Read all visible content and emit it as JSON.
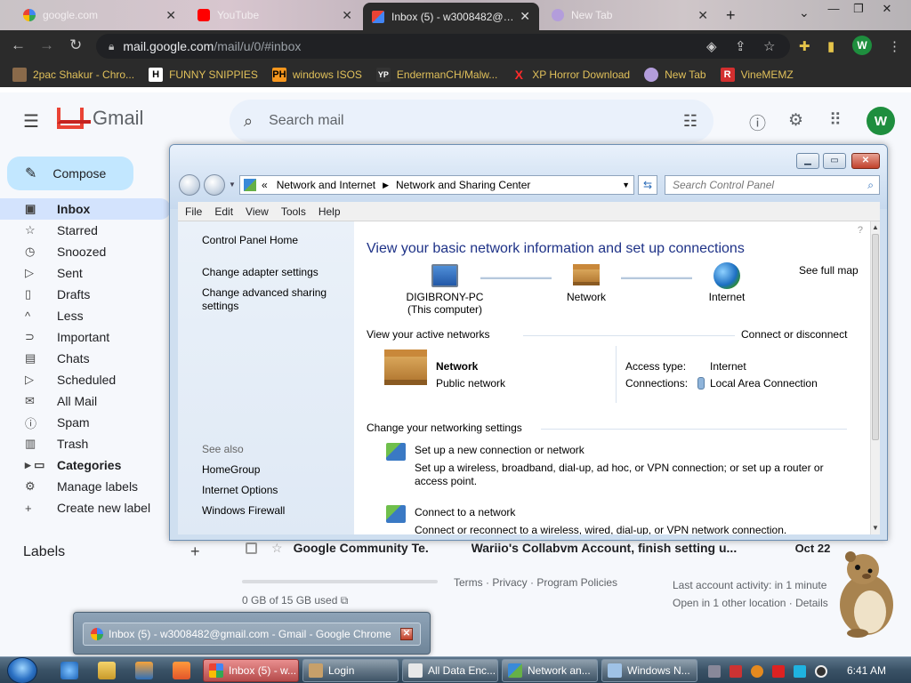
{
  "chrome": {
    "tabs": [
      {
        "title": "google.com"
      },
      {
        "title": "YouTube"
      },
      {
        "title": "Inbox (5) - w3008482@gmail.com"
      },
      {
        "title": "New Tab"
      }
    ],
    "url_host": "mail.google.com",
    "url_path": "/mail/u/0/#inbox",
    "profile_initial": "W",
    "bookmarks": [
      {
        "label": "2pac Shakur - Chro..."
      },
      {
        "label": "FUNNY SNIPPIES",
        "mark": "H"
      },
      {
        "label": "windows ISOS",
        "mark": "PH"
      },
      {
        "label": "EndermanCH/Malw...",
        "mark": "YP"
      },
      {
        "label": "XP Horror Download",
        "mark": "X"
      },
      {
        "label": "New Tab"
      },
      {
        "label": "VineMEMZ",
        "mark": "R"
      }
    ]
  },
  "gmail": {
    "brand": "Gmail",
    "search_placeholder": "Search mail",
    "avatar": "W",
    "compose": "Compose",
    "nav": [
      {
        "label": "Inbox",
        "icon": "inbox-icon"
      },
      {
        "label": "Starred",
        "icon": "star-icon"
      },
      {
        "label": "Snoozed",
        "icon": "clock-icon"
      },
      {
        "label": "Sent",
        "icon": "send-icon"
      },
      {
        "label": "Drafts",
        "icon": "draft-icon"
      },
      {
        "label": "Less",
        "icon": "chevron-up-icon"
      },
      {
        "label": "Important",
        "icon": "important-icon"
      },
      {
        "label": "Chats",
        "icon": "chat-icon"
      },
      {
        "label": "Scheduled",
        "icon": "schedule-icon"
      },
      {
        "label": "All Mail",
        "icon": "mail-icon"
      },
      {
        "label": "Spam",
        "icon": "spam-icon"
      },
      {
        "label": "Trash",
        "icon": "trash-icon"
      },
      {
        "label": "Categories",
        "icon": "label-icon"
      },
      {
        "label": "Manage labels",
        "icon": "gear-icon"
      },
      {
        "label": "Create new label",
        "icon": "plus-icon"
      }
    ],
    "labels_title": "Labels",
    "email": {
      "sender": "Google Community Te.",
      "subject": "Wariio's Collabvm Account, finish setting u...",
      "date": "Oct 22"
    },
    "storage": "0 GB of 15 GB used",
    "footer_links": "Terms · Privacy · Program Policies",
    "activity_line1": "Last account activity: in 1 minute",
    "activity_line2": "Open in 1 other location · Details"
  },
  "control_panel": {
    "breadcrumb_root": "«",
    "breadcrumb_1": "Network and Internet",
    "breadcrumb_2": "Network and Sharing Center",
    "search_placeholder": "Search Control Panel",
    "menu": [
      "File",
      "Edit",
      "View",
      "Tools",
      "Help"
    ],
    "left_links": {
      "home": "Control Panel Home",
      "adapter": "Change adapter settings",
      "sharing": "Change advanced sharing settings"
    },
    "see_also": {
      "title": "See also",
      "items": [
        "HomeGroup",
        "Internet Options",
        "Windows Firewall"
      ]
    },
    "main_title": "View your basic network information and set up connections",
    "see_full_map": "See full map",
    "nodes": {
      "computer": "DIGIBRONY-PC",
      "computer_sub": "(This computer)",
      "network": "Network",
      "internet": "Internet"
    },
    "active_networks_title": "View your active networks",
    "connect_disconnect": "Connect or disconnect",
    "active_network_name": "Network",
    "active_network_type": "Public network",
    "access_type_label": "Access type:",
    "access_type_value": "Internet",
    "connections_label": "Connections:",
    "connections_value": "Local Area Connection",
    "settings_title": "Change your networking settings",
    "task1_link": "Set up a new connection or network",
    "task1_desc": "Set up a wireless, broadband, dial-up, ad hoc, or VPN connection; or set up a router or access point.",
    "task2_link": "Connect to a network",
    "task2_desc": "Connect or reconnect to a wireless, wired, dial-up, or VPN network connection."
  },
  "thumbnail": {
    "title": "Inbox (5) - w3008482@gmail.com - Gmail - Google Chrome"
  },
  "taskbar": {
    "tasks": [
      {
        "label": "Inbox (5) - w..."
      },
      {
        "label": "Login"
      },
      {
        "label": "All Data Enc..."
      },
      {
        "label": "Network an..."
      },
      {
        "label": "Windows N..."
      }
    ],
    "clock": "6:41 AM"
  },
  "colors": {
    "gmail_accent": "#c2e7ff",
    "link_blue": "#1a55b5",
    "title_blue": "#1e3287",
    "active_task_red": "#b54b4b"
  }
}
